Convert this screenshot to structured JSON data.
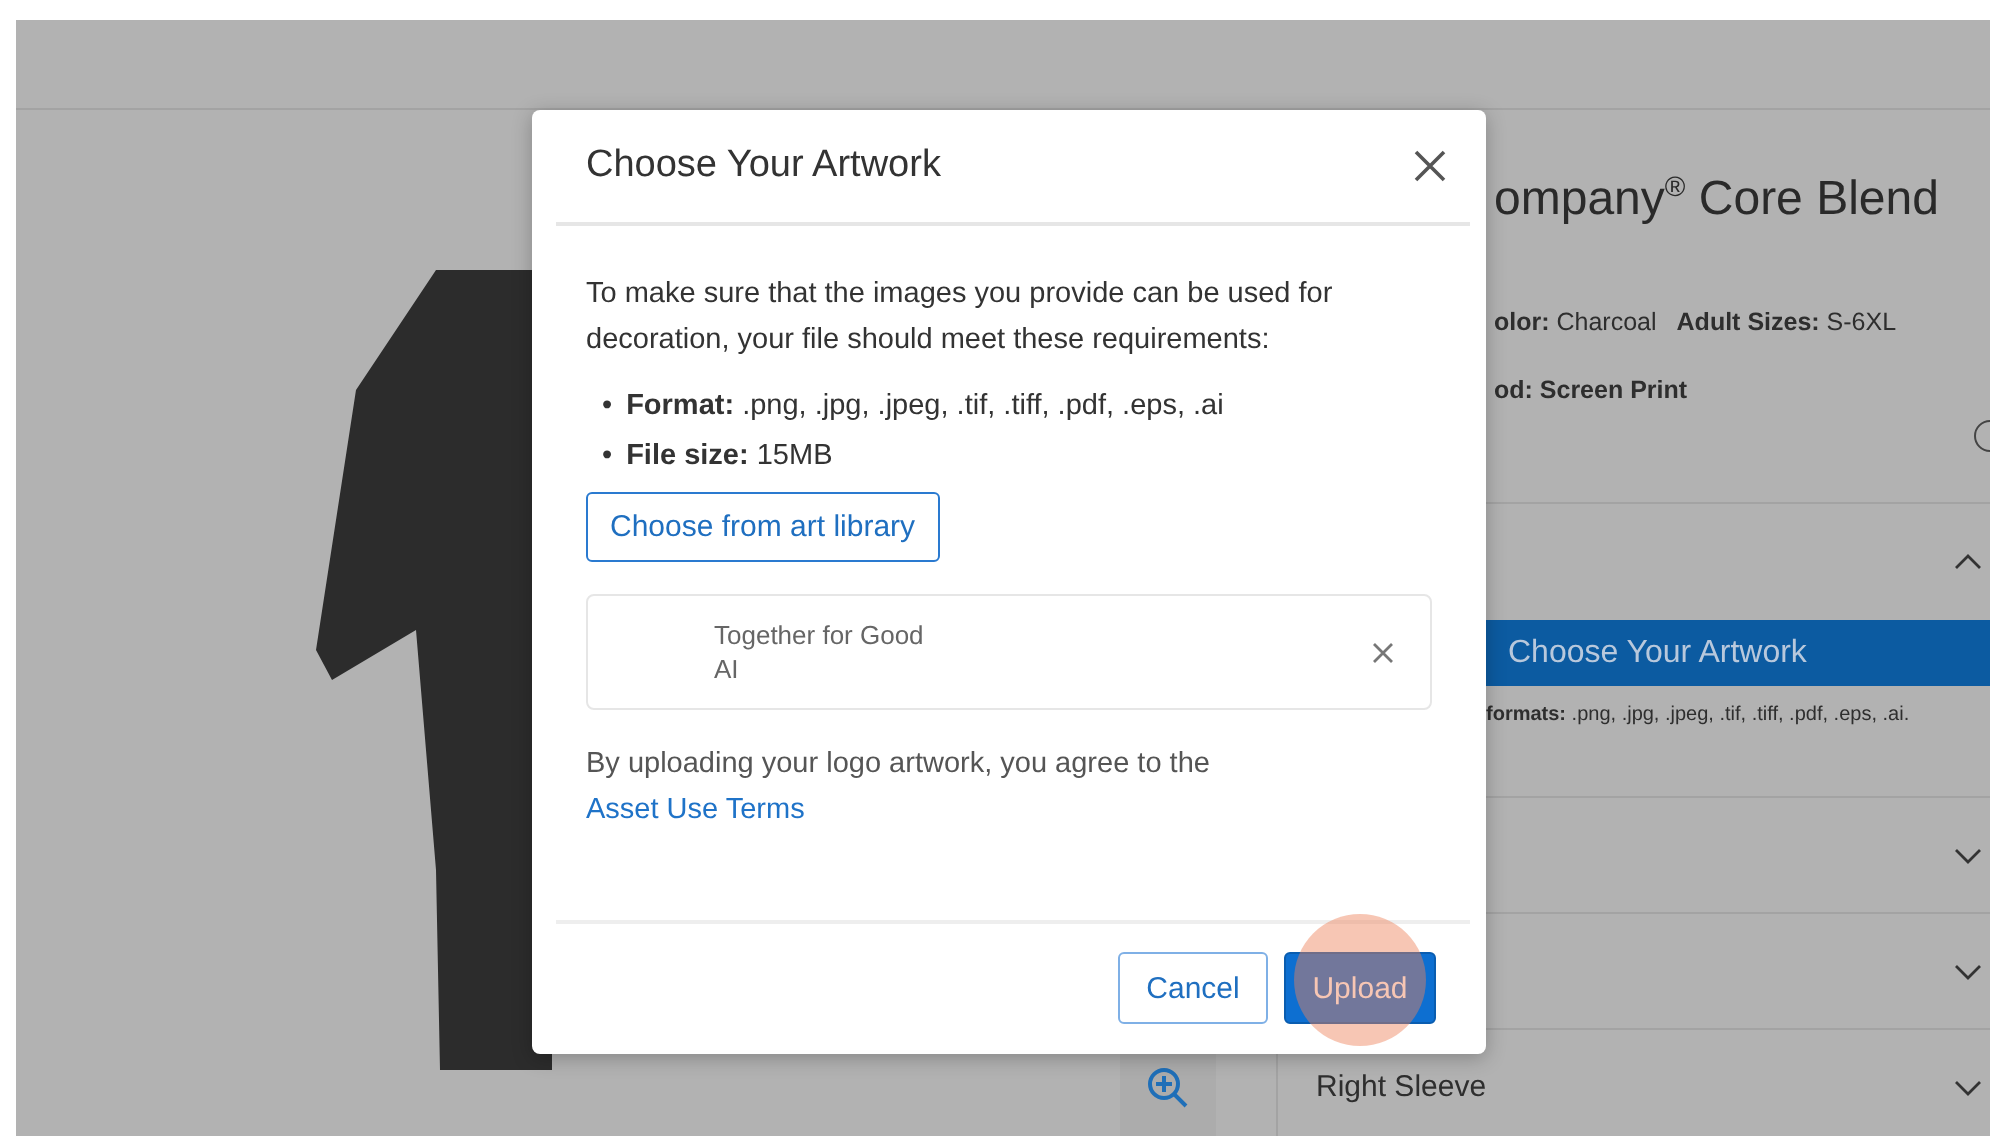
{
  "product": {
    "title": "ompany$^{®}$ Core Blend",
    "details": [
      {
        "text": "**olor:** Charcoal"
      },
      {
        "text": "**Adult Sizes:** S-6XL"
      }
    ],
    "method": "od: Screen Print",
    "accordion": [
      {
        "expanded": true,
        "action": "Choose Your Artwork",
        "note": "**formats:** .png, .jpg, .jpeg, .tif, .tiff, .pdf, .eps, .ai."
      },
      {
        "expanded": false
      },
      {
        "expanded": false
      },
      {
        "expanded": false,
        "label": "Right Sleeve"
      }
    ]
  },
  "dialog": {
    "title": "Choose Your Artwork",
    "intro": "To make sure that the images you provide can be used for decoration, your file should meet these requirements:",
    "requirements": [
      {
        "marker": "•",
        "text": "**Format:** .png, .jpg, .jpeg, .tif, .tiff, .pdf, .eps, .ai"
      },
      {
        "marker": "•",
        "text": "**File size:** 15MB"
      }
    ],
    "library_button": "Choose from art library",
    "file": {
      "name": "Together for Good",
      "type": "AI"
    },
    "terms": "By uploading your logo artwork, you agree to the",
    "terms_link": "Asset Use Terms",
    "buttons": [
      {
        "label": "Cancel",
        "kind": "secondary"
      },
      {
        "label": "Upload",
        "kind": "primary"
      }
    ]
  }
}
